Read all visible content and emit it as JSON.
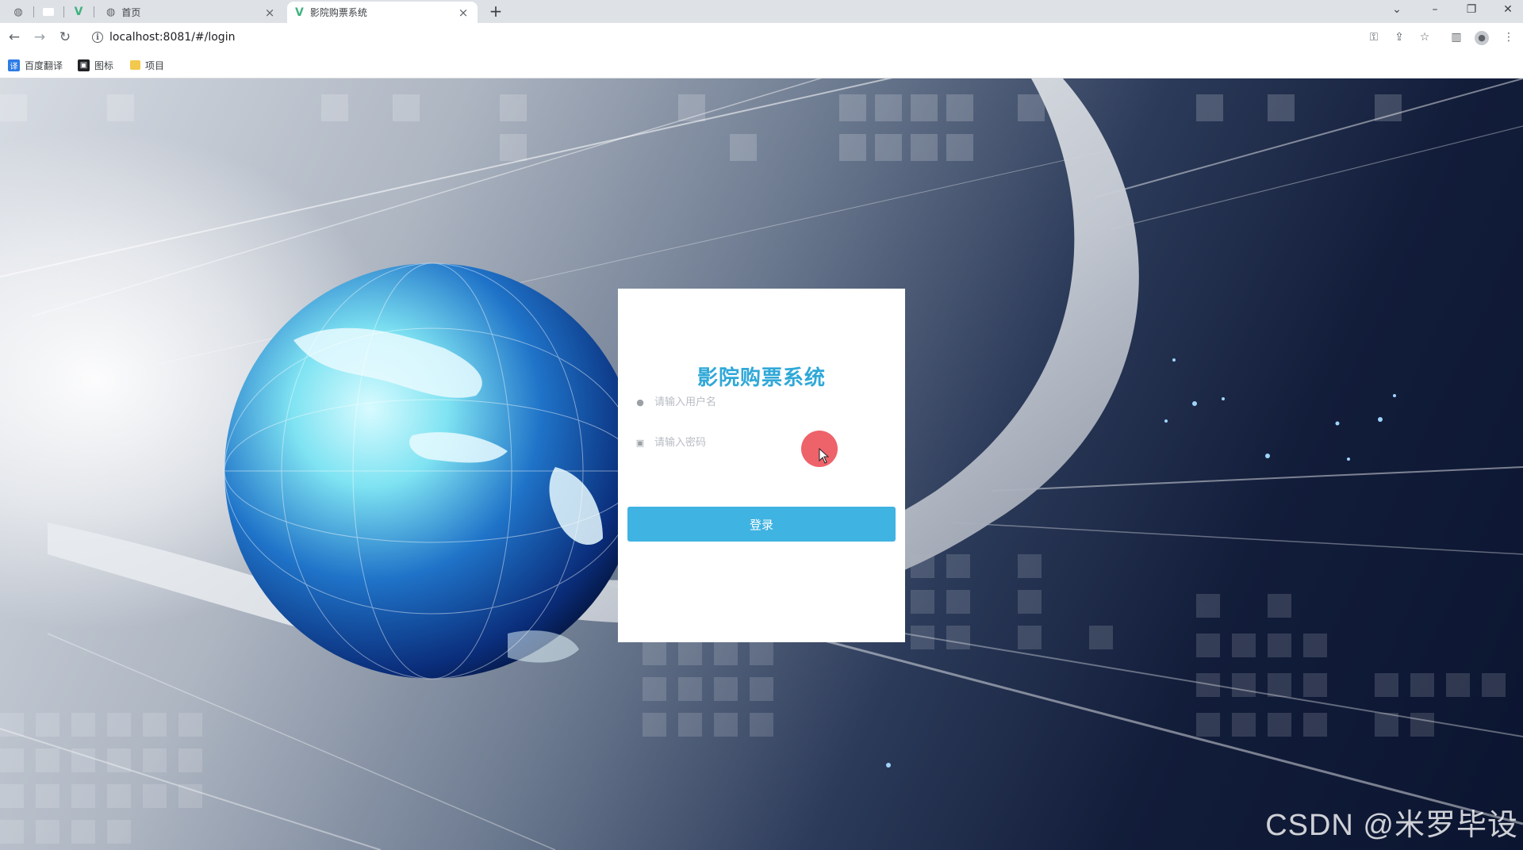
{
  "browser": {
    "tabs": [
      {
        "title": "首页",
        "icon": "globe-icon"
      },
      {
        "title": "影院购票系统",
        "icon": "vue-icon",
        "active": true
      }
    ],
    "new_tab_label": "+",
    "close_label": "×",
    "url": "localhost:8081/#/login",
    "bookmarks": [
      {
        "label": "百度翻译",
        "icon": "translate-icon",
        "color": "#2d7be5",
        "glyph": "译"
      },
      {
        "label": "图标",
        "icon": "image-icon",
        "color": "#202124",
        "glyph": "▣"
      },
      {
        "label": "项目",
        "icon": "folder-icon",
        "color": "#f2c94c",
        "glyph": ""
      }
    ]
  },
  "login": {
    "title": "影院购票系统",
    "username_placeholder": "请输入用户名",
    "password_placeholder": "请输入密码",
    "submit_label": "登录"
  },
  "watermark": "CSDN @米罗毕设",
  "colors": {
    "accent": "#3fb3e2",
    "title": "#2fa8d8"
  }
}
